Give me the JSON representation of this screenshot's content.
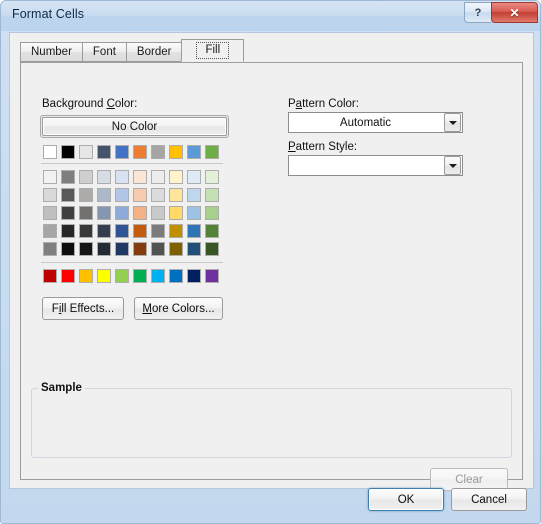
{
  "window": {
    "title": "Format Cells",
    "help_button": "?",
    "close_button": "✕"
  },
  "tabs": [
    {
      "label": "Number",
      "selected": false
    },
    {
      "label": "Font",
      "selected": false
    },
    {
      "label": "Border",
      "selected": false
    },
    {
      "label": "Fill",
      "selected": true
    }
  ],
  "background": {
    "label": "Background Color:",
    "label_prefix": "Background ",
    "label_accel": "C",
    "label_suffix": "olor:",
    "no_color_label": "No Color",
    "theme_colors_row": [
      "#FFFFFF",
      "#000000",
      "#E7E6E6",
      "#44546A",
      "#4472C4",
      "#ED7D31",
      "#A5A5A5",
      "#FFC000",
      "#5B9BD5",
      "#70AD47"
    ],
    "tint_rows": [
      [
        "#F2F2F2",
        "#7F7F7F",
        "#D0CECE",
        "#D6DCE4",
        "#D9E2F3",
        "#FBE5D5",
        "#EDEDED",
        "#FFF2CC",
        "#DEEBF6",
        "#E2EFD9"
      ],
      [
        "#D9D9D9",
        "#595959",
        "#AEAAAA",
        "#ACB9CA",
        "#B4C6E7",
        "#F7CBAC",
        "#DBDBDB",
        "#FFE599",
        "#BDD7EE",
        "#C5E0B3"
      ],
      [
        "#BFBFBF",
        "#3F3F3F",
        "#757070",
        "#8496B0",
        "#8EAADB",
        "#F4B183",
        "#C9C9C9",
        "#FFD966",
        "#9CC3E5",
        "#A8D08D"
      ],
      [
        "#A6A6A6",
        "#262626",
        "#3A3838",
        "#333F4F",
        "#2F5496",
        "#C55A11",
        "#7B7B7B",
        "#BF8F00",
        "#2E75B5",
        "#538135"
      ],
      [
        "#808080",
        "#0D0D0D",
        "#171616",
        "#222A35",
        "#1F3864",
        "#833C0B",
        "#525252",
        "#7F6000",
        "#1F4E79",
        "#375623"
      ]
    ],
    "standard_colors_row": [
      "#C00000",
      "#FF0000",
      "#FFC000",
      "#FFFF00",
      "#92D050",
      "#00B050",
      "#00B0F0",
      "#0070C0",
      "#002060",
      "#7030A0"
    ],
    "fill_effects_button": "Fill Effects...",
    "fill_effects_accel": "i",
    "more_colors_button": "More Colors...",
    "more_colors_accel": "M"
  },
  "pattern": {
    "color_label": "Pattern Color:",
    "color_label_accel": "a",
    "color_value": "Automatic",
    "style_label": "Pattern Style:",
    "style_label_accel": "P",
    "style_value": ""
  },
  "sample": {
    "group_title": "Sample",
    "content": ""
  },
  "footer": {
    "clear_button": "Clear",
    "clear_disabled": true,
    "ok_button": "OK",
    "cancel_button": "Cancel"
  },
  "colors": {
    "accent": "#3C7FB1",
    "dialog_bg": "#F0F0F0",
    "titlebar": "#C9DCF0",
    "close_red": "#C23F33"
  }
}
